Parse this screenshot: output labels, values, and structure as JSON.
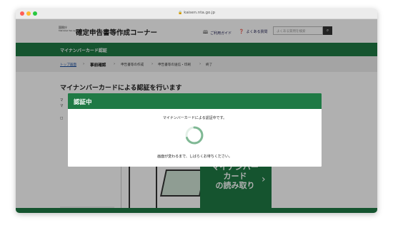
{
  "browser": {
    "url": "kaisen.nta.go.jp"
  },
  "header": {
    "logo_line1": "国税庁",
    "logo_line2": "National Tax Agency",
    "site_title": "確定申告書等作成コーナー",
    "guide_link": "ご利用ガイド",
    "faq_link": "よくある質問",
    "search_placeholder": "よくある質問を検索"
  },
  "subbar": {
    "title": "マイナンバーカード認証"
  },
  "steps": [
    {
      "label": "トップ画面"
    },
    {
      "label": "事前確認"
    },
    {
      "label": "申告書等の作成"
    },
    {
      "label": "申告書等の送信・印刷"
    },
    {
      "label": "終了"
    }
  ],
  "content": {
    "heading": "マイナンバーカードによる認証を行います",
    "line1": "マ",
    "line2": "マ",
    "line3": "□",
    "illustration_text": "マイナンバー\nカード\nの読み取り"
  },
  "modal": {
    "title": "認証中",
    "message": "マイナンバーカードによる認証中です。",
    "sub_message": "画面が変わるまで、しばらくお待ちください。"
  },
  "colors": {
    "brand_green": "#1f7a45",
    "spinner": "#7fb894"
  }
}
